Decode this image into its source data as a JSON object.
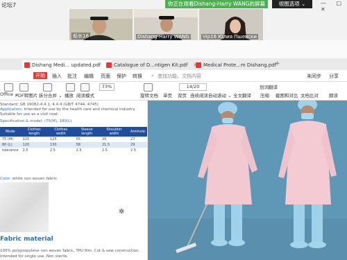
{
  "window": {
    "title": "论坛7",
    "controls": "— □ ✕"
  },
  "share_banner": "你正在观看Dishang-Harry WANG的屏幕",
  "view_options": "视图选项 ⌄",
  "participants": [
    {
      "name": "船长16"
    },
    {
      "name": "Dishang-Harry WANG"
    },
    {
      "name": "Vip16 Юлия Пшевски"
    }
  ],
  "tabs": [
    {
      "label": "Dishang Medi... updated.pdf"
    },
    {
      "label": "Catalogue of D...ntigen Kit.pdf"
    },
    {
      "label": "Medical Prote...m Dishang.pdf"
    }
  ],
  "menu": {
    "items": [
      "开始",
      "插入",
      "批注",
      "编辑",
      "页面",
      "保护",
      "转换"
    ],
    "search_placeholder": "查找功能、文档内容",
    "right": [
      "未同步",
      "分享"
    ]
  },
  "toolbar": {
    "items": [
      "Office ⌄",
      "PDF转图片",
      "拆分合并 ⌄",
      "播放",
      "阅读模式",
      "旋转文档",
      "单页",
      "双页",
      "连续阅读",
      "自动滚动 ⌄",
      "全文翻译",
      "压缩",
      "截图和对比",
      "文档比对",
      "朗读"
    ],
    "zoom": "73%",
    "page": "14/20",
    "annotation": "划词翻译"
  },
  "left_page": {
    "standard": "Standard: GB 19082-4.4.1, 4.4.4 (GB/T 4744, 4745)",
    "application_label": "Application:",
    "application_text": "Intended for use by the health care and chemical industry. Suitable for use as a visit coat.",
    "spec_heading": "Specification & model: (75(M), 180(L)",
    "spec_headers": [
      "Mode",
      "Clothes length",
      "Clothes width",
      "Sleeve length",
      "Shoulder width",
      "Armhole"
    ],
    "spec_rows": [
      [
        "75 (M)",
        "115",
        "125",
        "55",
        "20",
        "27"
      ],
      [
        "80 (L)",
        "120",
        "130",
        "58",
        "21.5",
        "29"
      ],
      [
        "tolerance",
        "2.5",
        "2.5",
        "2.5",
        "2.5",
        "2.5"
      ]
    ],
    "color_label": "Color:",
    "color_text": "white non woven fabric",
    "fabric_heading": "Fabric material",
    "fabric_line1": "100% polypropylene non woven fabric, TPU film. Cut & sew construction.",
    "fabric_line2": "Intended for single use. Non sterile."
  }
}
